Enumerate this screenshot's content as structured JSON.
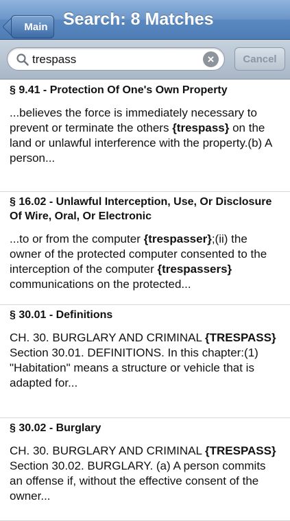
{
  "navbar": {
    "back_label": "Main",
    "title": "Search: 8 Matches"
  },
  "search": {
    "value": "trespass",
    "placeholder": "",
    "clear_icon": "clear-icon",
    "cancel_label": "Cancel"
  },
  "colors": {
    "navbar": "#6d97c9",
    "search_bar": "#b8c4d2",
    "divider": "#d6d6d6"
  },
  "results": [
    {
      "title": "§ 9.41 - Protection Of One's Own Property",
      "snippet": [
        {
          "t": "...believes the force is immediately necessary to prevent or terminate the others ",
          "b": false
        },
        {
          "t": "{trespass}",
          "b": true
        },
        {
          "t": " on the land or unlawful interference with the property.(b) A person...",
          "b": false
        }
      ]
    },
    {
      "title": "§ 16.02 - Unlawful Interception, Use, Or Disclosure Of Wire, Oral, Or Electronic",
      "snippet": [
        {
          "t": "...to or from the computer ",
          "b": false
        },
        {
          "t": "{trespasser}",
          "b": true
        },
        {
          "t": ";(ii) the owner of the protected computer consented to the interception of the computer ",
          "b": false
        },
        {
          "t": "{trespassers}",
          "b": true
        },
        {
          "t": " communications on the protected...",
          "b": false
        }
      ]
    },
    {
      "title": "§ 30.01 - Definitions",
      "snippet": [
        {
          "t": "CH. 30. BURGLARY AND CRIMINAL ",
          "b": false
        },
        {
          "t": "{TRESPASS}",
          "b": true
        },
        {
          "t": " Section 30.01. DEFINITIONS. In this chapter:(1) \"Habitation\" means a structure or vehicle that is adapted for...",
          "b": false
        }
      ]
    },
    {
      "title": "§ 30.02 - Burglary",
      "snippet": [
        {
          "t": "CH. 30. BURGLARY AND CRIMINAL ",
          "b": false
        },
        {
          "t": "{TRESPASS}",
          "b": true
        },
        {
          "t": " Section 30.02. BURGLARY. (a) A person commits an offense if, without the effective consent of the owner...",
          "b": false
        }
      ]
    }
  ]
}
